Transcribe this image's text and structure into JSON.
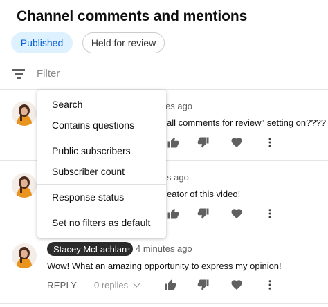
{
  "page": {
    "title": "Channel comments and mentions"
  },
  "tabs": {
    "published": "Published",
    "held_for_review": "Held for review"
  },
  "filter": {
    "placeholder": "Filter",
    "icon": "filter-icon"
  },
  "filter_menu": {
    "items": [
      "Search",
      "Contains questions",
      "Public subscribers",
      "Subscriber count",
      "Response status",
      "Set no filters as default"
    ]
  },
  "comments": [
    {
      "time_partial": "es ago",
      "text_partial": "all comments for review\" setting on????"
    },
    {
      "time_partial": "s ago",
      "text_partial": "eator of this video!"
    },
    {
      "author": "Stacey McLachlan",
      "separator": "•",
      "time": "4 minutes ago",
      "text": "Wow! What an amazing opportunity to express my opinion!",
      "reply_label": "REPLY",
      "replies_label": "0 replies"
    }
  ],
  "colors": {
    "accent": "#065fd4",
    "active_chip_bg": "#def1ff",
    "author_chip_bg": "#2b2b2b"
  },
  "icons": [
    "filter-icon",
    "thumbs-up-icon",
    "thumbs-down-icon",
    "heart-icon",
    "more-vert-icon",
    "chevron-down-icon",
    "avatar"
  ]
}
